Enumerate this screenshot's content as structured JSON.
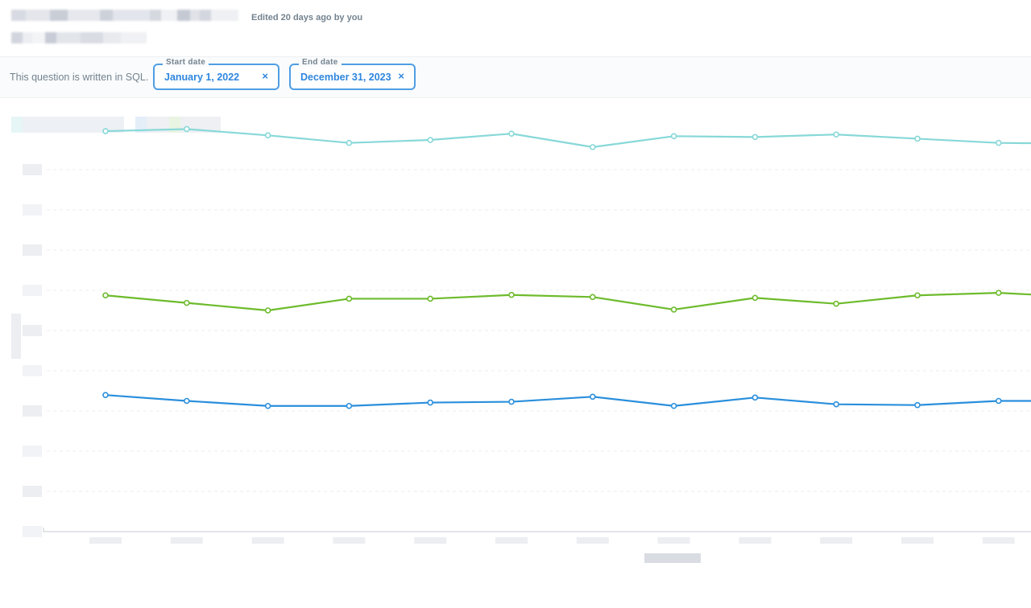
{
  "header": {
    "edited_text": "Edited 20 days ago by you"
  },
  "filters": {
    "sql_note": "This question is written in SQL.",
    "start_date": {
      "label": "Start date",
      "value": "January 1, 2022",
      "clear_icon": "×"
    },
    "end_date": {
      "label": "End date",
      "value": "December 31, 2023",
      "clear_icon": "×"
    }
  },
  "colors": {
    "accent": "#509ee3",
    "series_teal": "#88d8d8",
    "series_green": "#6dbb2c",
    "series_blue": "#2a8fdc"
  },
  "chart_data": {
    "type": "line",
    "ylim": [
      0,
      9.6
    ],
    "grid": true,
    "x_count": 12,
    "series": [
      {
        "color": "#88d8d8",
        "values": [
          9.56,
          9.61,
          9.46,
          9.28,
          9.35,
          9.5,
          9.18,
          9.44,
          9.42,
          9.48,
          9.38,
          9.28,
          9.26
        ]
      },
      {
        "color": "#6dbb2c",
        "values": [
          5.64,
          5.46,
          5.28,
          5.56,
          5.56,
          5.65,
          5.6,
          5.3,
          5.58,
          5.44,
          5.64,
          5.7,
          5.6
        ]
      },
      {
        "color": "#2a8fdc",
        "values": [
          3.26,
          3.12,
          3.0,
          3.0,
          3.08,
          3.1,
          3.22,
          3.0,
          3.2,
          3.04,
          3.02,
          3.12,
          3.12
        ]
      }
    ]
  }
}
